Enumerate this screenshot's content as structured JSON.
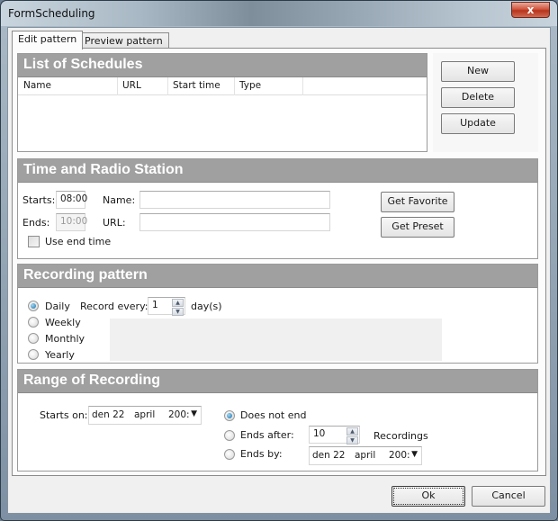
{
  "window": {
    "title": "FormScheduling",
    "close_label": "x"
  },
  "tabs": [
    {
      "label": "Edit pattern",
      "active": true
    },
    {
      "label": "Preview pattern",
      "active": false
    }
  ],
  "schedules": {
    "header": "List of Schedules",
    "columns": [
      "Name",
      "URL",
      "Start time",
      "Type"
    ],
    "rows": [],
    "buttons": {
      "new": "New",
      "delete": "Delete",
      "update": "Update"
    }
  },
  "time_station": {
    "header": "Time and Radio Station",
    "starts_label": "Starts:",
    "starts_value": "08:00",
    "ends_label": "Ends:",
    "ends_value": "10:00",
    "use_end_time_label": "Use end time",
    "use_end_time_checked": false,
    "name_label": "Name:",
    "name_value": "",
    "url_label": "URL:",
    "url_value": "",
    "get_favorite_label": "Get Favorite",
    "get_preset_label": "Get Preset"
  },
  "recording_pattern": {
    "header": "Recording pattern",
    "options": [
      {
        "label": "Daily",
        "checked": true
      },
      {
        "label": "Weekly",
        "checked": false
      },
      {
        "label": "Monthly",
        "checked": false
      },
      {
        "label": "Yearly",
        "checked": false
      }
    ],
    "record_every_label": "Record every:",
    "record_every_value": "1",
    "unit_label": "day(s)"
  },
  "range": {
    "header": "Range of Recording",
    "starts_on_label": "Starts on:",
    "starts_on": {
      "day": "den 22",
      "month": "april",
      "year": "200:"
    },
    "options": [
      {
        "label": "Does not end",
        "checked": true
      },
      {
        "label": "Ends after:",
        "checked": false
      },
      {
        "label": "Ends by:",
        "checked": false
      }
    ],
    "ends_after_value": "10",
    "recordings_label": "Recordings",
    "ends_by": {
      "day": "den 22",
      "month": "april",
      "year": "200:"
    }
  },
  "footer": {
    "ok_label": "Ok",
    "cancel_label": "Cancel"
  }
}
